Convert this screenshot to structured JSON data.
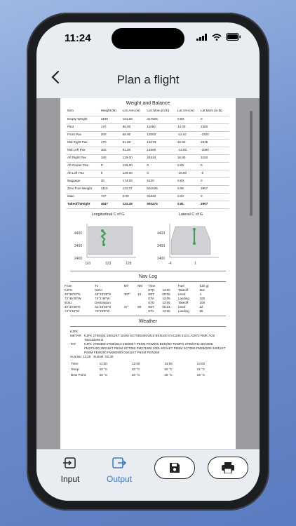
{
  "status": {
    "time": "11:24"
  },
  "header": {
    "title": "Plan a flight"
  },
  "weight_balance": {
    "title": "Weight and Balance",
    "columns": [
      "Item",
      "Weight (lb)",
      "Lon Arm (in)",
      "Lon Mom (in.lb)",
      "Lat Arm (in)",
      "Lat Mom (in.lb)"
    ],
    "rows": [
      [
        "Empty Weight",
        "3190",
        "131.00",
        "417825",
        "0.00",
        "0"
      ],
      [
        "Pilot",
        "170",
        "65.00",
        "11050",
        "14.00",
        "2380"
      ],
      [
        "Front Pax",
        "200",
        "65.00",
        "13000",
        "-11.10",
        "-2220"
      ],
      [
        "Mid Right Pax",
        "170",
        "91.00",
        "15470",
        "15.50",
        "2635"
      ],
      [
        "Mid Left Pax",
        "160",
        "91.00",
        "14560",
        "-13.00",
        "-2080"
      ],
      [
        "Aft Right Pax",
        "190",
        "129.00",
        "24510",
        "16.80",
        "3192"
      ],
      [
        "Aft Center Pax",
        "0",
        "129.00",
        "0",
        "0.00",
        "0"
      ],
      [
        "Aft Left Pax",
        "0",
        "129.00",
        "0",
        "-16.80",
        "-0"
      ],
      [
        "Baggage",
        "30",
        "174.00",
        "5220",
        "0.00",
        "0"
      ],
      [
        "Zero Fuel Weight",
        "4110",
        "122.07",
        "501635",
        "0.95",
        "3907"
      ],
      [
        "Main",
        "737",
        "0.00",
        "91840",
        "0.00",
        "0"
      ]
    ],
    "total": [
      "Takeoff Weight",
      "4847",
      "122.45",
      "593475",
      "0.81",
      "3907"
    ]
  },
  "charts": {
    "longitudinal": {
      "title": "Longitudinal C of G",
      "yticks": [
        "4400",
        "3400",
        "2400"
      ],
      "xticks": [
        "118",
        "123",
        "128"
      ]
    },
    "lateral": {
      "title": "Lateral C of G",
      "yticks": [
        "4400",
        "3400",
        "2400"
      ],
      "xticks": [
        "-4",
        "1"
      ]
    },
    "line_color": "#3f9f56"
  },
  "navlog": {
    "title": "Nav Log",
    "columns": [
      "From",
      "To",
      "MT",
      "NM",
      "Time",
      "",
      "Fuel",
      "(US g)"
    ],
    "rows": [
      [
        "KJFK",
        "91NJ",
        "",
        "",
        "ETD",
        "12:00",
        "Takeoff",
        "112"
      ],
      [
        "40°38'22\"N",
        "40°43'28\"N",
        "307°",
        "13",
        "EET",
        "00:05",
        "Used",
        "4"
      ],
      [
        "73°46'45\"W",
        "74°1'46\"W",
        "",
        "",
        "ETA",
        "12:05",
        "Landing",
        "108"
      ],
      [
        "91NJ",
        "Destination",
        "",
        "",
        "ETD",
        "12:05",
        "Takeoff",
        "108"
      ],
      [
        "40°43'28\"N",
        "41°45'28\"N",
        "37°",
        "69",
        "EET",
        "00:31",
        "Used",
        "22"
      ],
      [
        "74°1'46\"W",
        "73°23'9\"W",
        "",
        "",
        "ETA",
        "12:36",
        "Landing",
        "86"
      ]
    ]
  },
  "weather": {
    "title": "Weather",
    "station": "KJFK",
    "metar_label": "METAR",
    "metar": "KJFK 270919Z 28012KT 10SM SCT005 BKN016 BKN100 OVC200 21/21 A2972 RMK AO2 T02110206 $",
    "taf_label": "TAF",
    "taf": "KJFK 270838Z 2709/2812 25008KT P6SM FEW005 BKN050 TEMPO 2709/2711 BKN005 FM271400 29011KT P6SM SCT050 FM271800 2001 6G24KT P6SM SCT050 FM280200 34012KT P6SM FEW250 FM280900 01011KT P6SM FEW250",
    "sunrise": "Sunrise: 11:26",
    "sunset": "Sunset: 02:30",
    "forecast_rows": [
      [
        "Time:",
        "11:00",
        "12:00",
        "13:00",
        "14:00"
      ],
      [
        "Temp:",
        "20 °C",
        "20 °C",
        "20 °C",
        "21 °C"
      ],
      [
        "Dew Point:",
        "20 °C",
        "20 °C",
        "19 °C",
        "19 °C"
      ]
    ]
  },
  "tabbar": {
    "input_label": "Input",
    "output_label": "Output",
    "active_color": "#3a78c2"
  }
}
